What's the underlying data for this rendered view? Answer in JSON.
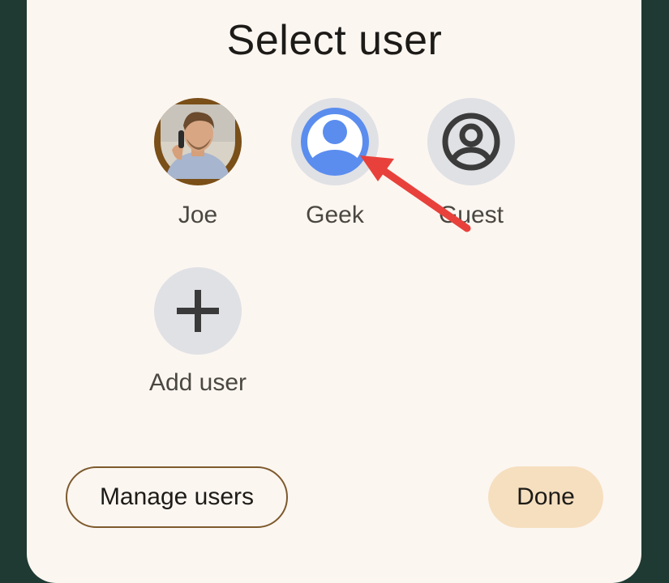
{
  "dialog": {
    "title": "Select user"
  },
  "users": [
    {
      "label": "Joe",
      "avatar": "photo-avatar"
    },
    {
      "label": "Geek",
      "avatar": "account-circle-icon"
    },
    {
      "label": "Guest",
      "avatar": "account-circle-outline-icon"
    }
  ],
  "add_user": {
    "label": "Add user",
    "icon": "plus-icon"
  },
  "buttons": {
    "manage": "Manage users",
    "done": "Done"
  },
  "colors": {
    "dialog_bg": "#fcf6f1",
    "accent_blue": "#5b8def",
    "annotation_arrow": "#e8413b",
    "done_bg": "#f6dfbf",
    "manage_border": "#7d5a2c"
  }
}
